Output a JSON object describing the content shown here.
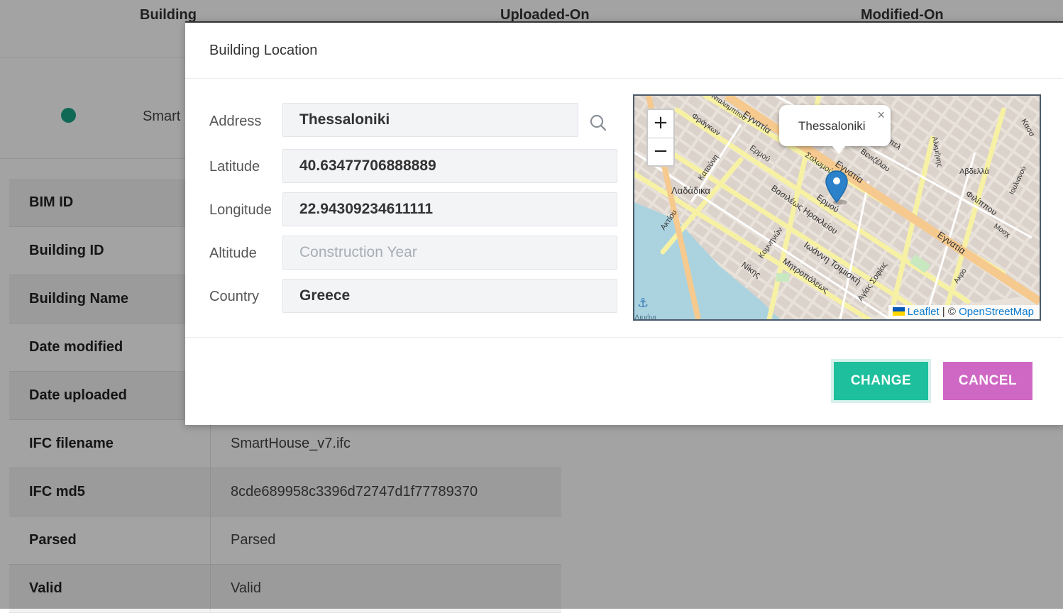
{
  "background": {
    "columns": [
      "Building",
      "Uploaded-On",
      "Modified-On"
    ],
    "row_text": "Smart",
    "status_color": "#19a486",
    "details": [
      {
        "key": "BIM ID",
        "value": ""
      },
      {
        "key": "Building ID",
        "value": ""
      },
      {
        "key": "Building Name",
        "value": ""
      },
      {
        "key": "Date modified",
        "value": ""
      },
      {
        "key": "Date uploaded",
        "value": ""
      },
      {
        "key": "IFC filename",
        "value": "SmartHouse_v7.ifc"
      },
      {
        "key": "IFC md5",
        "value": "8cde689958c3396d72747d1f77789370"
      },
      {
        "key": "Parsed",
        "value": "Parsed"
      },
      {
        "key": "Valid",
        "value": "Valid"
      }
    ]
  },
  "modal": {
    "title": "Building Location",
    "fields": {
      "address": {
        "label": "Address",
        "value": "Thessaloniki",
        "placeholder": ""
      },
      "latitude": {
        "label": "Latitude",
        "value": "40.63477706888889",
        "placeholder": ""
      },
      "longitude": {
        "label": "Longitude",
        "value": "22.94309234611111",
        "placeholder": ""
      },
      "altitude": {
        "label": "Altitude",
        "value": "",
        "placeholder": "Construction Year"
      },
      "country": {
        "label": "Country",
        "value": "Greece",
        "placeholder": ""
      }
    },
    "search_icon": "search-icon",
    "map": {
      "zoom_in": "+",
      "zoom_out": "−",
      "popup_text": "Thessaloniki",
      "popup_close": "×",
      "attribution_leaflet": "Leaflet",
      "attribution_sep": " | © ",
      "attribution_osm": "OpenStreetMap",
      "labels": {
        "egnatia1": "Εγνατία",
        "egnatia2": "Εγνατία",
        "egnatia3": "Εγνατία",
        "ermou1": "Ερμού",
        "ermou2": "Ερμού",
        "irakleiou": "Βασιλέως Ηρακλείου",
        "tsimiski": "Ιωάννη Τσιμισκή",
        "mitropoleos": "Μητροπόλεως",
        "nikis": "Νίκης",
        "ladadika": "Λαδάδικα",
        "frangon": "Φράγκων",
        "katouni": "Κατούνη",
        "aktiou": "Ακτίου",
        "komninon": "Κομνηνών",
        "agias_sofias": "Αγίας Σοφίας",
        "solomou": "Σολωμού",
        "venizelou": "Βενιζέλου",
        "alkminis": "Αλκμήνης",
        "filippou": "Φιλίππου",
        "avdella": "Αβδελλά",
        "olympou": "Ολύμπου",
        "mosh": "Μοσχ",
        "iouliou": "Ιουλιανού",
        "kassandrou": "Κασσ",
        "akro": "Ακρο",
        "ntalampo": "Νταλαμπίτου",
        "apel": "Απελ",
        "limanaki": "Λιμάνι"
      },
      "colors": {
        "water": "#aad3df",
        "land": "#e8e2da",
        "major_road": "#f6c98e",
        "minor_road": "#f7f1a4",
        "block": "#d9d0c9"
      }
    },
    "buttons": {
      "change": "CHANGE",
      "cancel": "CANCEL"
    },
    "colors": {
      "change": "#1dbf9c",
      "cancel": "#cf68c4"
    }
  }
}
